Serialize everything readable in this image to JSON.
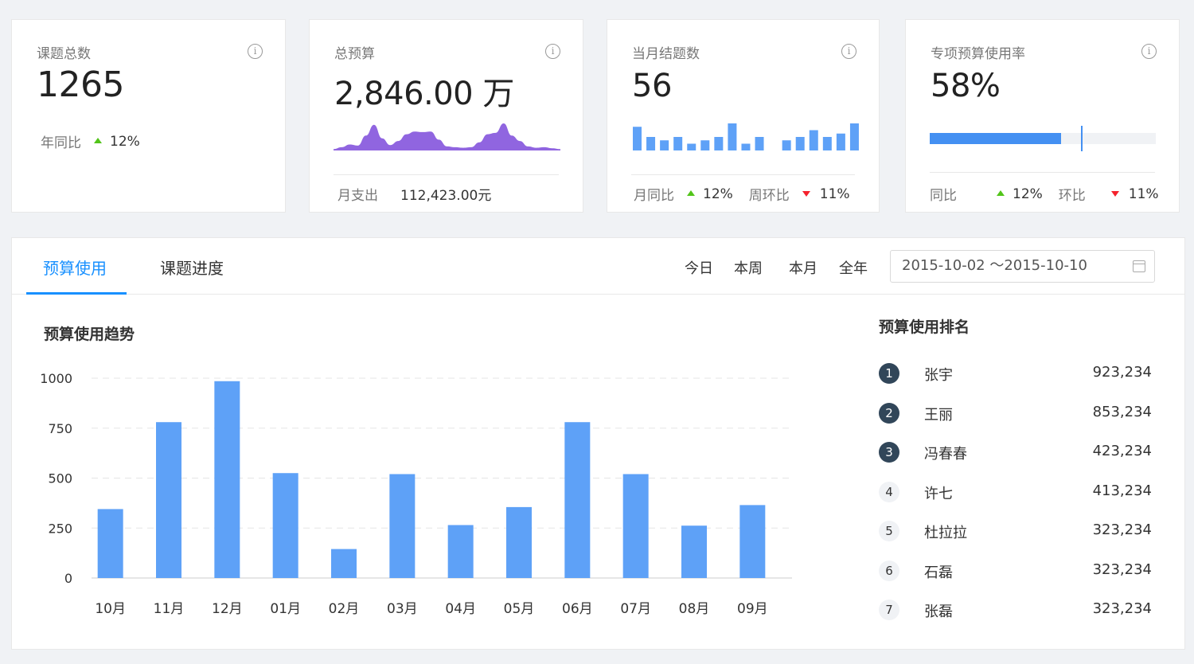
{
  "cards": [
    {
      "title": "课题总数",
      "value": "1265",
      "footer": {
        "label": "年同比",
        "val": "12%"
      }
    },
    {
      "title": "总预算",
      "value": "2,846.00 万",
      "footer": {
        "label": "月支出",
        "val": "112,423.00元"
      },
      "area_data": [
        0.05,
        0.12,
        0.22,
        0.18,
        0.55,
        0.95,
        0.45,
        0.2,
        0.35,
        0.6,
        0.7,
        0.68,
        0.7,
        0.4,
        0.15,
        0.12,
        0.1,
        0.12,
        0.3,
        0.6,
        0.65,
        1.0,
        0.55,
        0.35,
        0.15,
        0.1,
        0.12,
        0.08,
        0.05
      ]
    },
    {
      "title": "当月结题数",
      "value": "56",
      "footer": {
        "label1": "月同比",
        "val1": "12%",
        "label2": "周环比",
        "val2": "11%"
      },
      "mini_bars": [
        7,
        4,
        3,
        4,
        2,
        3,
        4,
        8,
        2,
        4,
        0,
        3,
        4,
        6,
        4,
        5,
        8
      ]
    },
    {
      "title": "专项预算使用率",
      "value": "58%",
      "progress": 0.58,
      "target": 0.67,
      "footer": {
        "label1": "同比",
        "val1": "12%",
        "label2": "环比",
        "val2": "11%"
      }
    }
  ],
  "tabs": [
    "预算使用",
    "课题进度"
  ],
  "ranges": [
    "今日",
    "本周",
    "本月",
    "全年"
  ],
  "date_range": "2015-10-02 ～2015-10-10",
  "chart_title": "预算使用趋势",
  "chart_data": {
    "type": "bar",
    "categories": [
      "10月",
      "11月",
      "12月",
      "01月",
      "02月",
      "03月",
      "04月",
      "05月",
      "06月",
      "07月",
      "08月",
      "09月"
    ],
    "values": [
      345,
      780,
      985,
      525,
      145,
      520,
      265,
      355,
      780,
      520,
      262,
      365
    ],
    "ylim": [
      0,
      1000
    ],
    "yticks": [
      0,
      250,
      500,
      750,
      1000
    ],
    "color": "#5ea1f7"
  },
  "ranking": {
    "title": "预算使用排名",
    "items": [
      {
        "no": "1",
        "name": "张宇",
        "value": "923,234"
      },
      {
        "no": "2",
        "name": "王丽",
        "value": "853,234"
      },
      {
        "no": "3",
        "name": "冯春春",
        "value": "423,234"
      },
      {
        "no": "4",
        "name": "许七",
        "value": "413,234"
      },
      {
        "no": "5",
        "name": "杜拉拉",
        "value": "323,234"
      },
      {
        "no": "6",
        "name": "石磊",
        "value": "323,234"
      },
      {
        "no": "7",
        "name": "张磊",
        "value": "323,234"
      }
    ]
  },
  "colors": {
    "accent": "#1890ff",
    "bar": "#5ea1f7",
    "area": "#9065e0",
    "up": "#52c41a",
    "down": "#f5222d",
    "rank_top": "#314659"
  }
}
